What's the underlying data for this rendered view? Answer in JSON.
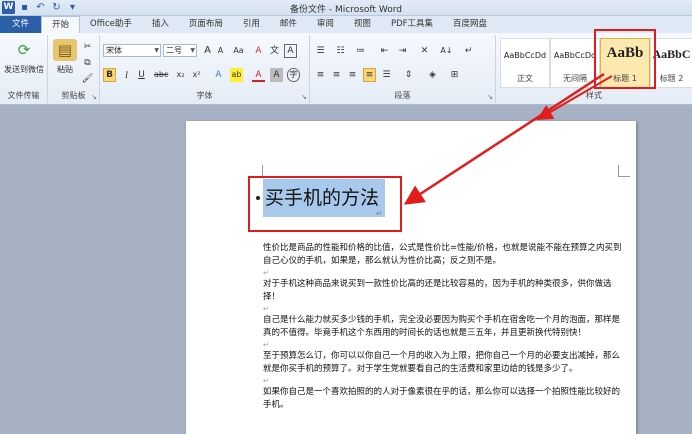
{
  "window": {
    "title": "备份文件 - Microsoft Word",
    "app_logo": "W"
  },
  "qat": {
    "save_icon": "save-icon",
    "undo_icon": "undo-icon",
    "redo_icon": "redo-icon",
    "customize_icon": "qat-customize-icon"
  },
  "tabs": [
    {
      "label": "文件"
    },
    {
      "label": "开始"
    },
    {
      "label": "Office助手"
    },
    {
      "label": "插入"
    },
    {
      "label": "页面布局"
    },
    {
      "label": "引用"
    },
    {
      "label": "邮件"
    },
    {
      "label": "审阅"
    },
    {
      "label": "视图"
    },
    {
      "label": "PDF工具集"
    },
    {
      "label": "百度网盘"
    }
  ],
  "ribbon": {
    "file_transfer": {
      "send_label": "发送到微信",
      "group_label": "文件传输"
    },
    "clipboard": {
      "paste_label": "粘贴",
      "cut_glyph": "✂",
      "copy_glyph": "⧉",
      "format_painter_glyph": "🖌",
      "group_label": "剪贴板"
    },
    "font": {
      "font_name": "宋体",
      "font_size": "二号",
      "grow": "A",
      "shrink": "A",
      "case": "Aa",
      "clear": "A",
      "phonetic": "文",
      "border_char": "A",
      "bold": "B",
      "italic": "I",
      "underline": "U",
      "strike": "abc",
      "subscript": "x₂",
      "superscript": "x²",
      "effects": "A",
      "highlight": "ab",
      "font_color": "A",
      "shading": "A",
      "enclose": "字",
      "group_label": "字体"
    },
    "paragraph": {
      "group_label": "段落",
      "sort_glyph": "A↓",
      "marks_glyph": "↵"
    },
    "styles": {
      "group_label": "样式",
      "items": [
        {
          "sample": "AaBbCcDd",
          "name": "正文"
        },
        {
          "sample": "AaBbCcDd",
          "name": "无间隔"
        },
        {
          "sample": "AaBb",
          "name": "标题 1"
        },
        {
          "sample": "AaBbC",
          "name": "标题 2"
        }
      ]
    }
  },
  "document": {
    "heading": "买手机的方法",
    "paragraphs": [
      "性价比是商品的性能和价格的比值，公式是性价比=性能/价格，也就是说能不能在预算之内买到自己心仪的手机，如果是，那么就认为性价比高；反之则不是。",
      "对于手机这种商品来说买到一款性价比高的还是比较容易的，因为手机的种类很多，供你做选择！",
      "自己是什么能力就买多少钱的手机，完全没必要因为购买个手机在宿舍吃一个月的泡面，那样是真的不值得。毕竟手机这个东西用的时间长的话也就是三五年，并且更新换代特别快！",
      "至于预算怎么订，你可以以你自己一个月的收入为上限，把你自己一个月的必要支出减掉，那么就是你买手机的预算了。对于学生党就要看自己的生活费和家里边给的钱是多少了。",
      "如果你自己是一个喜欢拍照的的人对于像素很在乎的话，那么你可以选择一个拍照性能比较好的手机。"
    ],
    "para_mark": "↵"
  },
  "colors": {
    "accent": "#2b5fa8",
    "highlight": "#a8c9ec",
    "callout": "#e21b1b",
    "selected_style": "#fde9b0"
  }
}
